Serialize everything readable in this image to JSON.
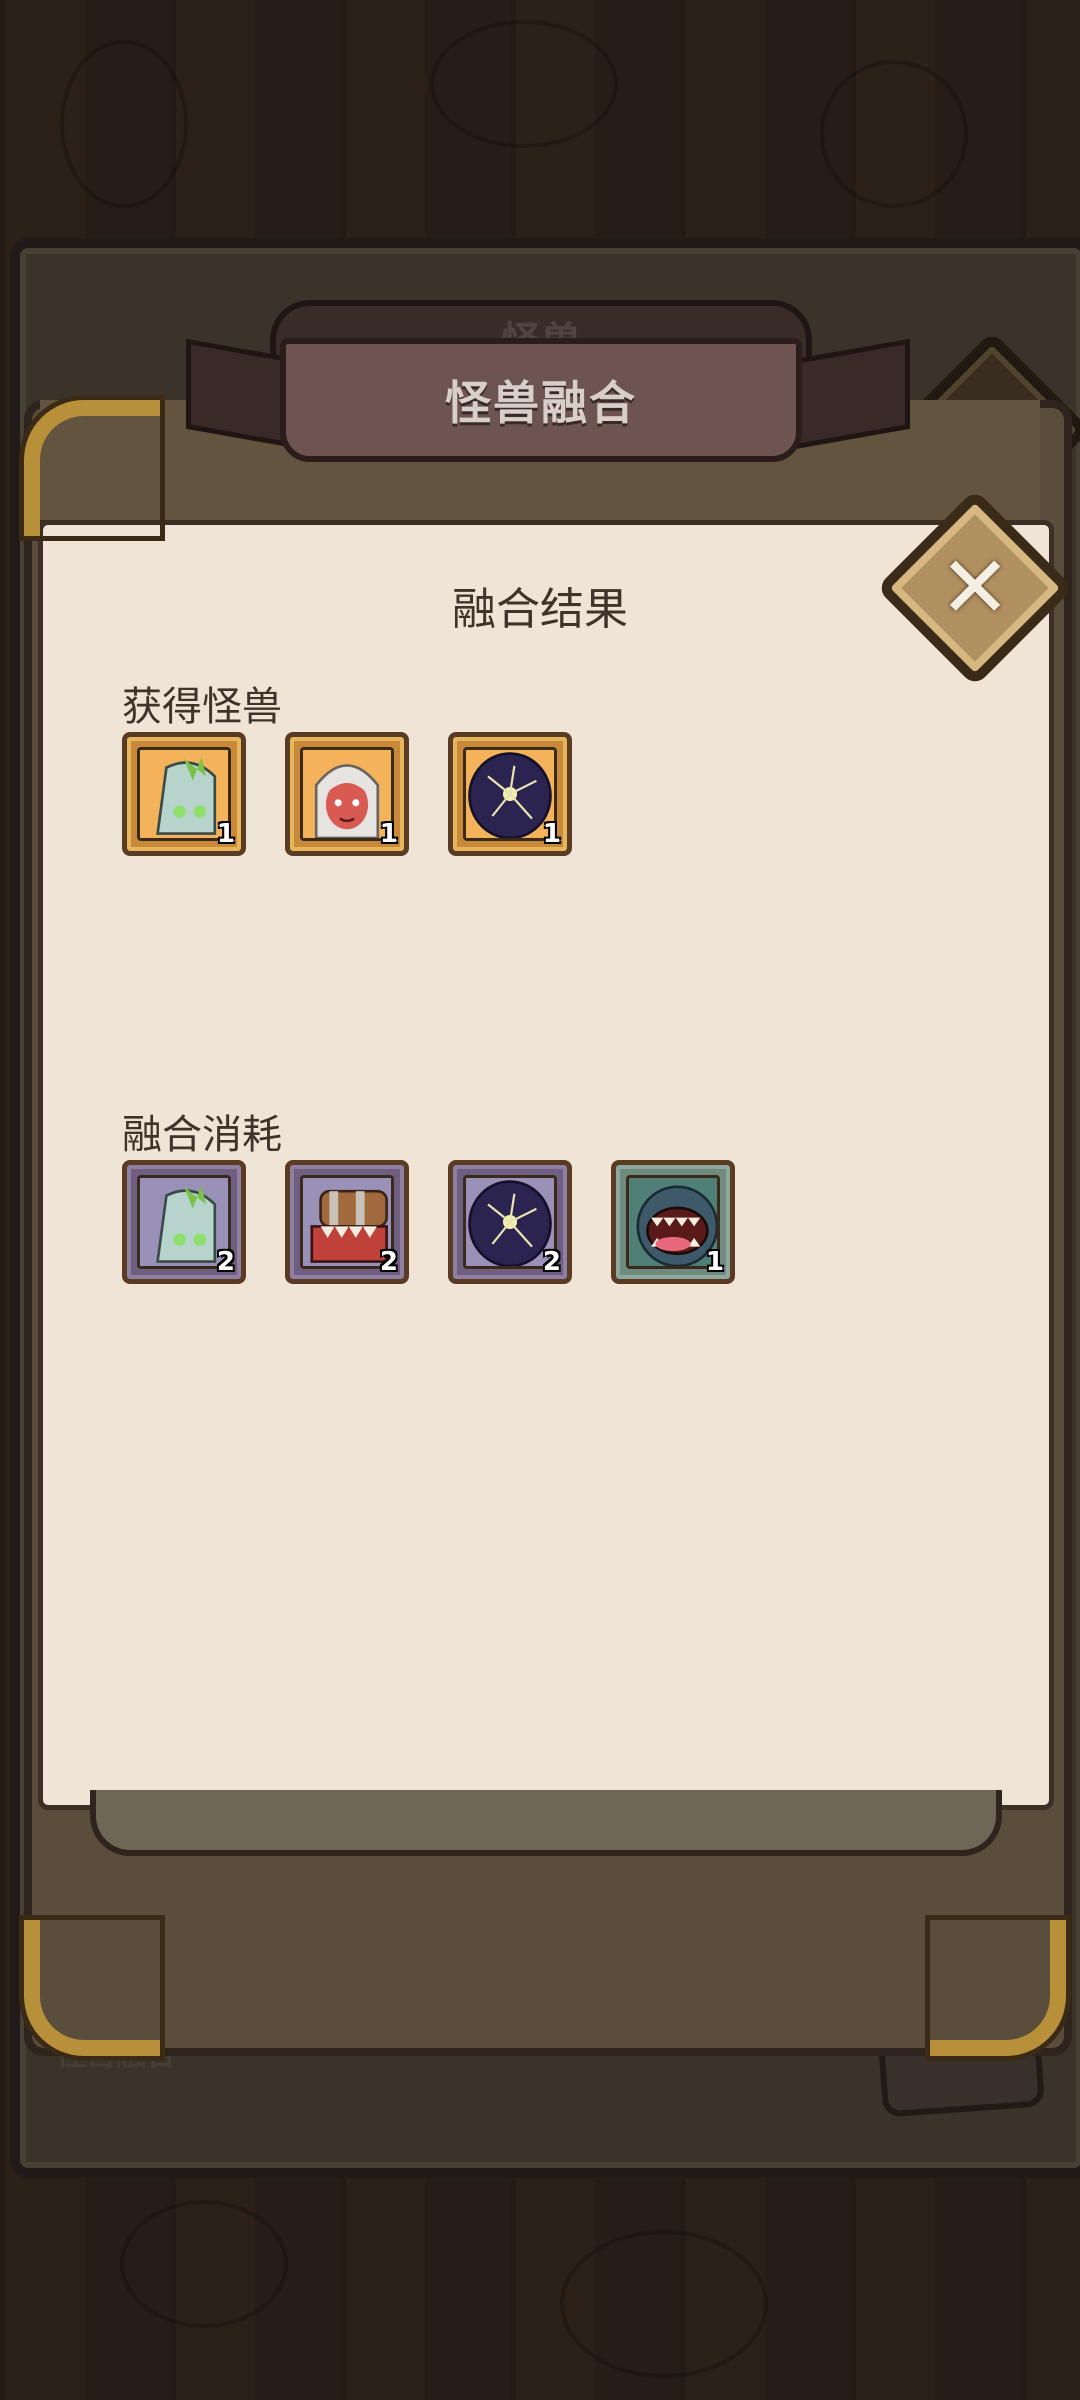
{
  "window": {
    "title": "怪兽融合",
    "back_title": "怪兽",
    "back_bottom_label": "怪兽融合"
  },
  "panel": {
    "result_title": "融合结果",
    "obtained": {
      "label": "获得怪兽",
      "items": [
        {
          "icon": "ghost-robot-icon",
          "count": "1",
          "rarity": "gold"
        },
        {
          "icon": "white-haired-girl-icon",
          "count": "1",
          "rarity": "gold"
        },
        {
          "icon": "dark-egg-icon",
          "count": "1",
          "rarity": "gold"
        }
      ]
    },
    "consumed": {
      "label": "融合消耗",
      "items": [
        {
          "icon": "ghost-robot-icon",
          "count": "2",
          "rarity": "purple"
        },
        {
          "icon": "chest-mimic-icon",
          "count": "2",
          "rarity": "purple"
        },
        {
          "icon": "dark-egg-icon",
          "count": "2",
          "rarity": "purple"
        },
        {
          "icon": "screaming-fish-icon",
          "count": "1",
          "rarity": "teal"
        }
      ]
    }
  },
  "colors": {
    "parchment": "#efe4d6",
    "gold_frame": "#c8893a",
    "purple_frame": "#6e5f80",
    "teal_frame": "#6f8b80"
  }
}
